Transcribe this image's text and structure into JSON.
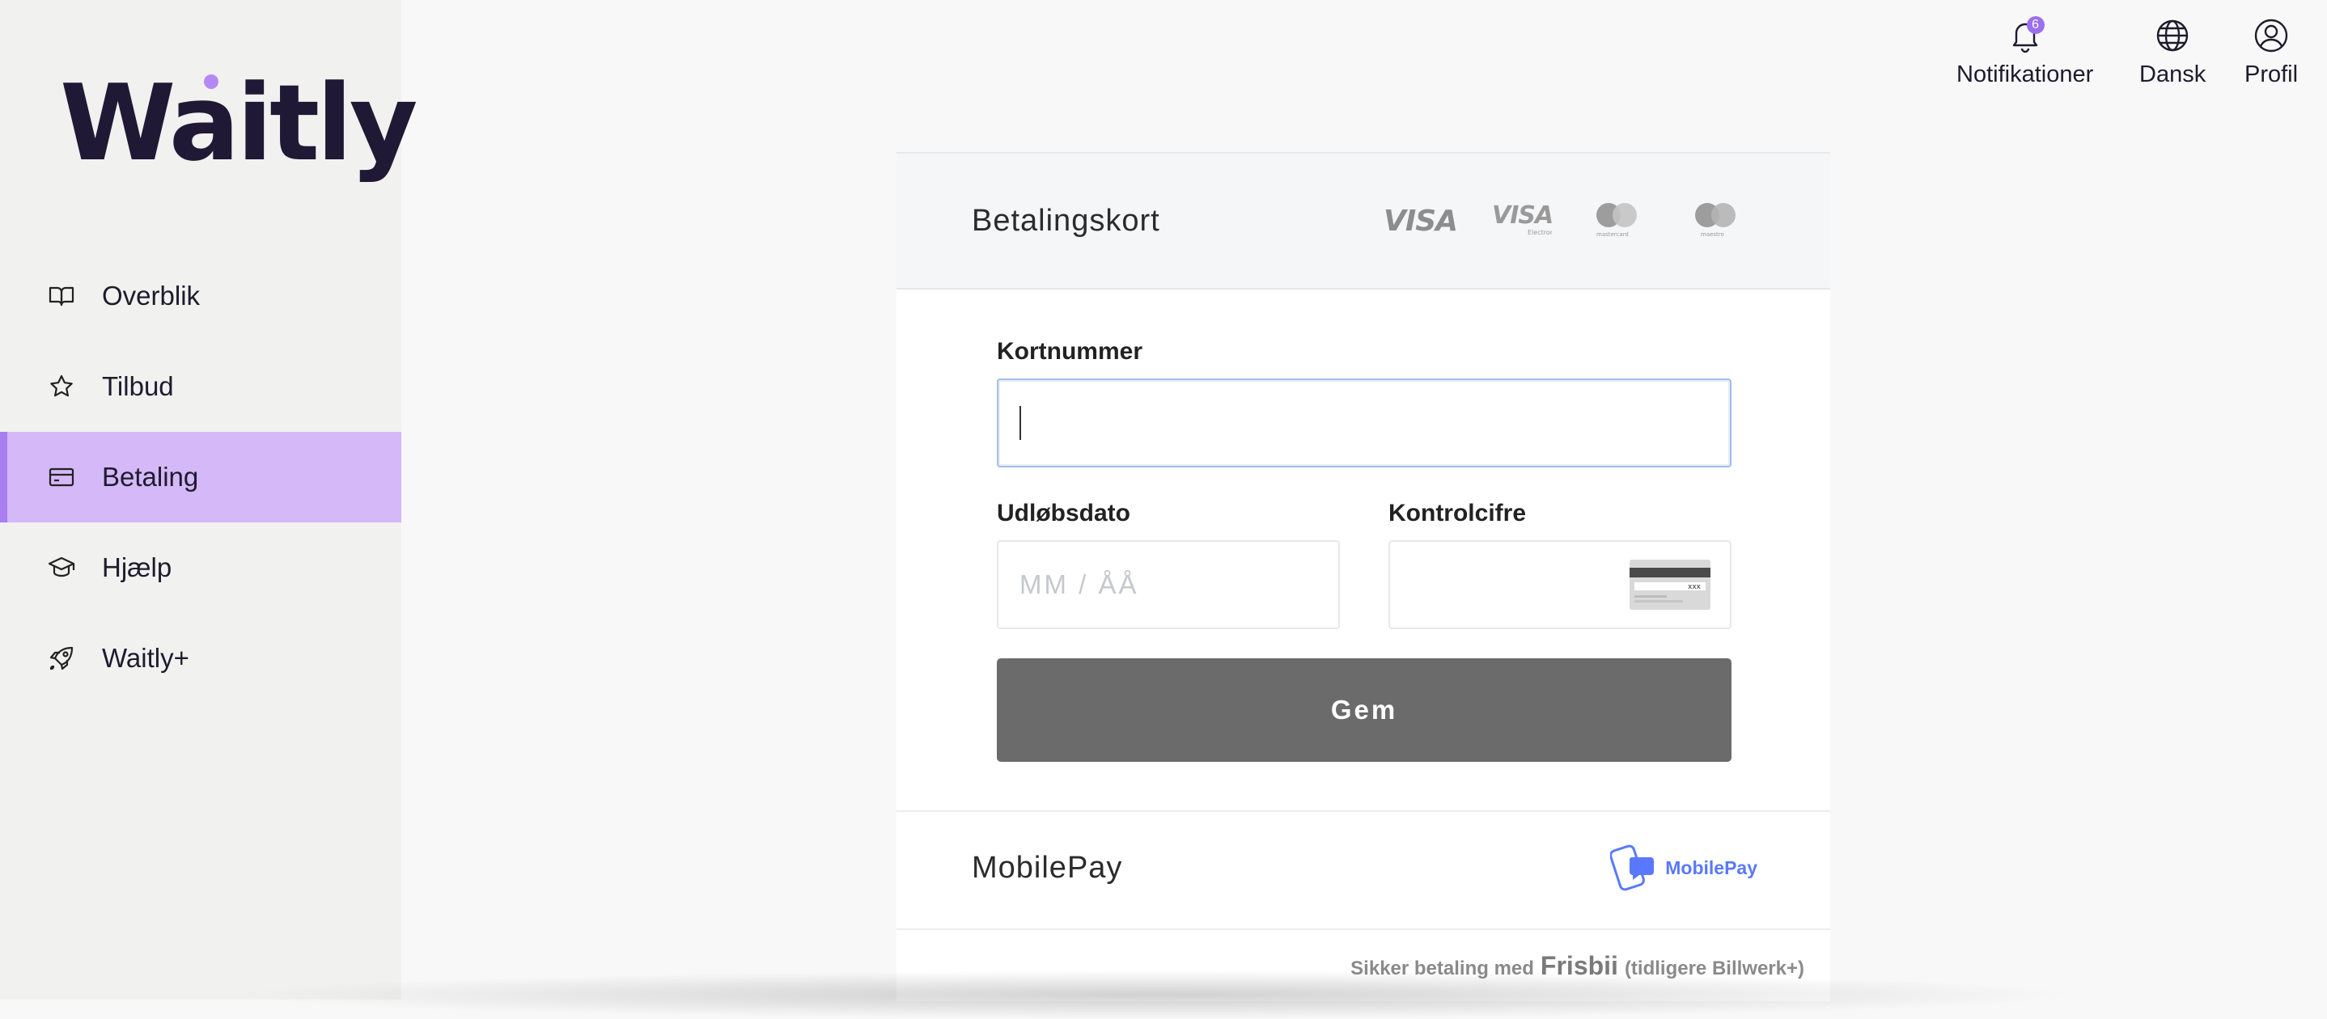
{
  "brand": {
    "name": "Waitly",
    "accent": "#a97ef0",
    "active_bg": "#d4b8f7"
  },
  "sidebar": {
    "items": [
      {
        "label": "Overblik",
        "icon": "book-icon"
      },
      {
        "label": "Tilbud",
        "icon": "star-icon"
      },
      {
        "label": "Betaling",
        "icon": "credit-card-icon",
        "active": true
      },
      {
        "label": "Hjælp",
        "icon": "graduation-cap-icon"
      },
      {
        "label": "Waitly+",
        "icon": "rocket-icon"
      }
    ]
  },
  "topbar": {
    "notifications": {
      "label": "Notifikationer",
      "count": "6"
    },
    "language": {
      "label": "Dansk"
    },
    "profile": {
      "label": "Profil"
    }
  },
  "payment": {
    "card_section_title": "Betalingskort",
    "brands": [
      "VISA",
      "VISA Electron",
      "mastercard",
      "maestro"
    ],
    "card_number_label": "Kortnummer",
    "card_number_value": "",
    "expiry_label": "Udløbsdato",
    "expiry_placeholder": "MM / ÅÅ",
    "cvc_label": "Kontrolcifre",
    "cvc_hint": "xxx",
    "save_label": "Gem",
    "mobilepay_title": "MobilePay",
    "mobilepay_logo_text": "MobilePay",
    "secure_prefix": "Sikker betaling med",
    "secure_brand": "Frisbii",
    "secure_suffix": "(tidligere Billwerk+)"
  }
}
